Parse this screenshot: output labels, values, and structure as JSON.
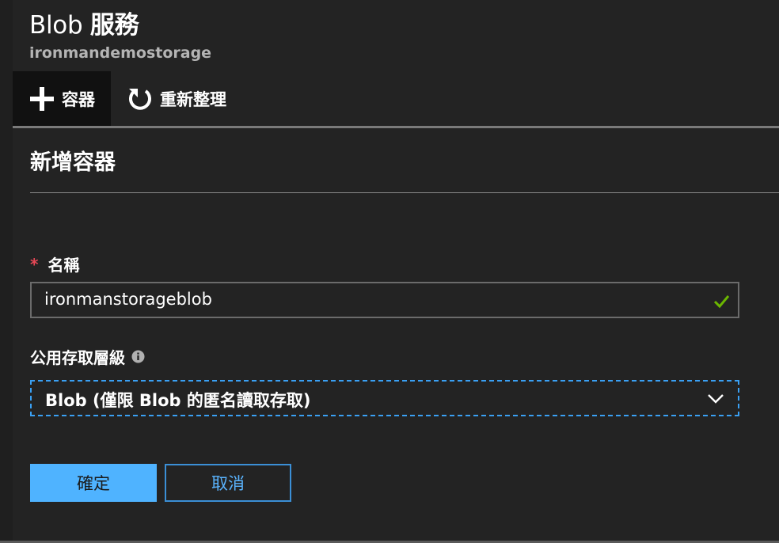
{
  "header": {
    "title_en": "Blob",
    "title_zh": "服務",
    "subtitle": "ironmandemostorage"
  },
  "toolbar": {
    "add_container_label": "容器",
    "refresh_label": "重新整理"
  },
  "form": {
    "section_title": "新增容器",
    "name_required_mark": "*",
    "name_label": "名稱",
    "name_value": "ironmanstorageblob",
    "access_label": "公用存取層級",
    "access_value": "Blob (僅限 Blob 的匿名讀取存取)",
    "ok_label": "確定",
    "cancel_label": "取消"
  },
  "colors": {
    "accent": "#4fb3ff",
    "required": "#e74856",
    "valid_check": "#6bb700",
    "focus_border": "#3aa0f3"
  },
  "icons": {
    "add": "plus-icon",
    "refresh": "refresh-icon",
    "valid": "checkmark-icon",
    "info": "info-icon",
    "dropdown": "chevron-down-icon"
  }
}
